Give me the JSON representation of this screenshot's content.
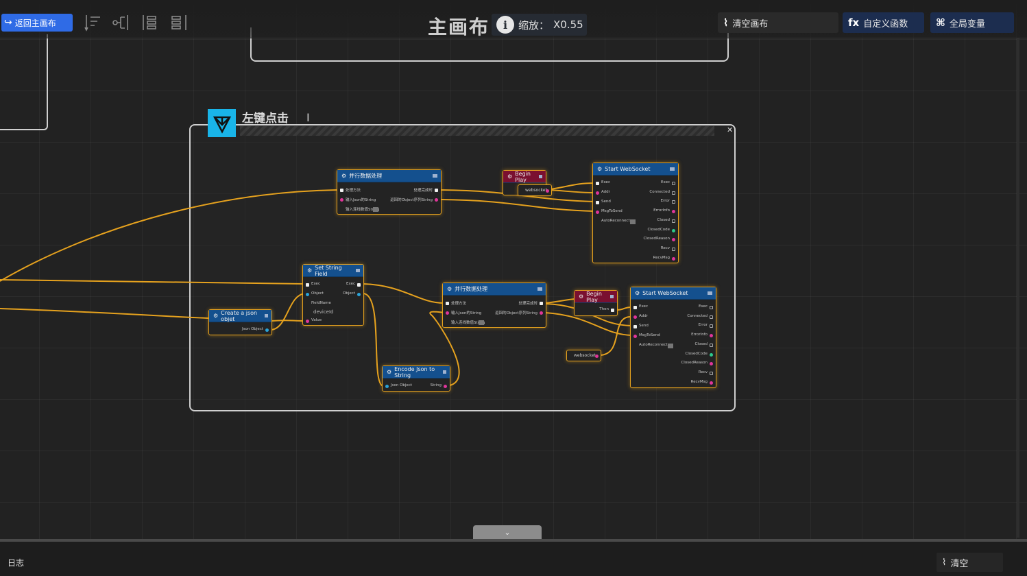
{
  "toolbar": {
    "back_label": "返回主画布",
    "title": "主画布",
    "zoom_label": "缩放：",
    "zoom_value": "X0.55",
    "clear_canvas_label": "清空画布",
    "custom_func_label": "自定义函数",
    "global_vars_label": "全局变量",
    "fx_glyph": "fx"
  },
  "group": {
    "title": "左键点击"
  },
  "nodes": {
    "parallel1": {
      "title": "并行数据处理",
      "in": [
        "处理方法",
        "输入Json的String",
        "输入连线数值String"
      ],
      "out": [
        "处理完成时",
        "返回的Object序列String"
      ]
    },
    "begin_play1": {
      "title": "Begin Play"
    },
    "websocket_var1": {
      "label": "websocket"
    },
    "start_ws1": {
      "title": "Start WebSocket",
      "in": [
        "Exec",
        "Addr",
        "Send",
        "MsgToSend",
        "AutoReconnect"
      ],
      "out": [
        "Exec",
        "Connected",
        "Error",
        "ErrorInfo",
        "Closed",
        "ClosedCode",
        "ClosedReason",
        "Recv",
        "RecvMsg"
      ]
    },
    "set_string": {
      "title": "Set String Field",
      "in": [
        "Exec",
        "Object",
        "FieldName",
        "Value"
      ],
      "out": [
        "Exec",
        "Object"
      ],
      "field_value": "deviceId"
    },
    "create_json": {
      "title": "Create a json objet",
      "out": [
        "Json Object"
      ]
    },
    "encode_json": {
      "title": "Encode Json to String",
      "in": [
        "Json Object"
      ],
      "out": [
        "String"
      ]
    },
    "parallel2": {
      "title": "并行数据处理",
      "in": [
        "处理方法",
        "输入Json的String",
        "输入连线数值String"
      ],
      "out": [
        "处理完成时",
        "返回的Object序列String"
      ]
    },
    "begin_play2": {
      "title": "Begin Play",
      "out": [
        "Then"
      ]
    },
    "websocket_var2": {
      "label": "websocket"
    },
    "start_ws2": {
      "title": "Start WebSocket",
      "in": [
        "Exec",
        "Addr",
        "Send",
        "MsgToSend",
        "AutoReconnect"
      ],
      "out": [
        "Exec",
        "Connected",
        "Error",
        "ErrorInfo",
        "Closed",
        "ClosedCode",
        "ClosedReason",
        "Recv",
        "RecvMsg"
      ]
    }
  },
  "bottom": {
    "log_label": "日志",
    "clear_label": "清空"
  },
  "colors": {
    "wire": "#e6a21e",
    "node_header_blue": "#14508e",
    "node_header_red": "#7a1030",
    "accent": "#2f6be6",
    "group_icon": "#19b4e8"
  }
}
